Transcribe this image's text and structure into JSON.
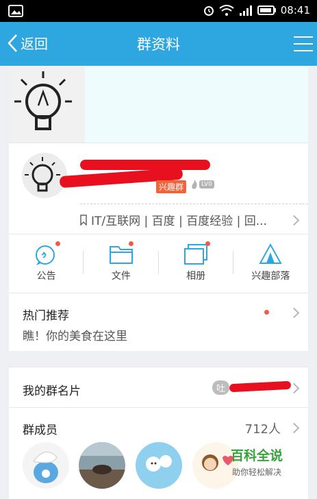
{
  "status_bar": {
    "time": "08:41"
  },
  "header": {
    "back_label": "返回",
    "title": "群资料"
  },
  "group": {
    "badge": "兴趣群",
    "level": "LV0",
    "tags": "IT/互联网 | 百度 | 百度经验 | 回..."
  },
  "actions": [
    {
      "label": "公告",
      "icon": "announcement-icon"
    },
    {
      "label": "文件",
      "icon": "folder-icon"
    },
    {
      "label": "相册",
      "icon": "album-icon"
    },
    {
      "label": "兴趣部落",
      "icon": "tent-icon"
    }
  ],
  "hot": {
    "title": "热门推荐",
    "subtitle": "瞧！你的美食在这里"
  },
  "card": {
    "title": "我的群名片",
    "prefix": "吐"
  },
  "members": {
    "title": "群成员",
    "count": "712人"
  },
  "watermark": {
    "title": "百科全说",
    "subtitle": "助你轻松解决"
  },
  "colors": {
    "header_bg": "#2ea7e0",
    "accent": "#2ea7e0",
    "dot": "#f25b43",
    "badge": "#f0643c",
    "watermark": "#35a43a"
  }
}
